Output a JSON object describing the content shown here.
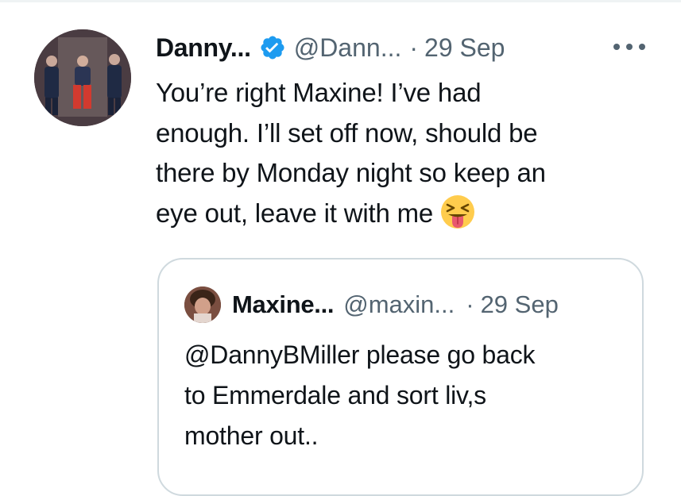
{
  "tweet": {
    "author_name": "Danny...",
    "verified_icon": "verified-badge-icon",
    "handle": "@Dann...",
    "separator": "·",
    "date": "29 Sep",
    "more_icon": "more-options-icon",
    "text_lines": [
      "You’re right Maxine! I’ve had",
      "enough. I’ll set off now, should be",
      "there by Monday night so keep an",
      "eye out, leave it with me"
    ],
    "emoji": "squinting-face-with-tongue-emoji"
  },
  "quoted_tweet": {
    "author_name": "Maxine...",
    "handle": "@maxin...",
    "separator": "·",
    "date": "29 Sep",
    "text_lines": [
      "@DannyBMiller please go back",
      "to Emmerdale and sort liv,s",
      "mother out.."
    ]
  },
  "colors": {
    "text_primary": "#0f1419",
    "text_secondary": "#536471",
    "verified_blue": "#1d9bf0",
    "quote_border": "#cfd9de"
  }
}
